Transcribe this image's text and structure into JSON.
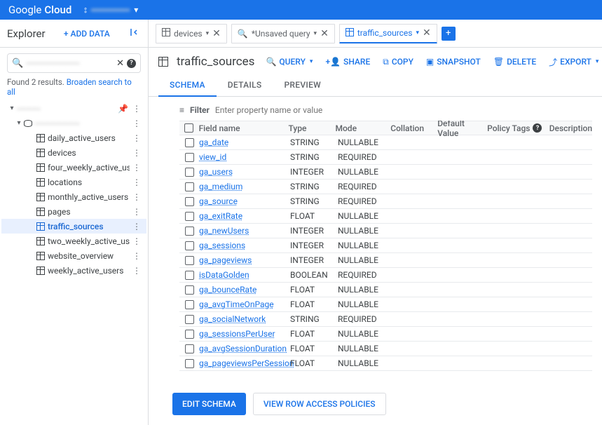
{
  "header": {
    "product": "Google",
    "product_b": "Cloud",
    "project": "▪▪▪▪▪▪▪▪▪▪▪▪▪"
  },
  "sidebar": {
    "title": "Explorer",
    "add_data": "ADD DATA",
    "search_value": "▪▪▪▪▪▪▪▪▪▪▪▪▪▪▪▪▪▪",
    "results_text": "Found 2 results.",
    "broaden": "Broaden search to all",
    "tree_project": "▪▪▪▪▪▪▪▪",
    "tree_dataset": "▪▪▪▪▪▪▪▪▪▪▪▪▪▪▪",
    "tables": [
      "daily_active_users",
      "devices",
      "four_weekly_active_users",
      "locations",
      "monthly_active_users",
      "pages",
      "traffic_sources",
      "two_weekly_active_users",
      "website_overview",
      "weekly_active_users"
    ],
    "selected_table": "traffic_sources"
  },
  "tabs": [
    {
      "icon": "table",
      "label": "devices",
      "active": false
    },
    {
      "icon": "search",
      "label": "*Unsaved query",
      "active": false
    },
    {
      "icon": "table",
      "label": "traffic_sources",
      "active": true
    }
  ],
  "page": {
    "title": "traffic_sources",
    "actions": {
      "query": "QUERY",
      "share": "SHARE",
      "copy": "COPY",
      "snapshot": "SNAPSHOT",
      "delete": "DELETE",
      "export": "EXPORT"
    },
    "subtabs": [
      "SCHEMA",
      "DETAILS",
      "PREVIEW"
    ],
    "active_subtab": "SCHEMA"
  },
  "filter": {
    "label": "Filter",
    "placeholder": "Enter property name or value"
  },
  "schema": {
    "headers": {
      "name": "Field name",
      "type": "Type",
      "mode": "Mode",
      "collation": "Collation",
      "default": "Default Value",
      "tags": "Policy Tags",
      "desc": "Description"
    },
    "fields": [
      {
        "name": "ga_date",
        "type": "STRING",
        "mode": "NULLABLE"
      },
      {
        "name": "view_id",
        "type": "STRING",
        "mode": "REQUIRED"
      },
      {
        "name": "ga_users",
        "type": "INTEGER",
        "mode": "NULLABLE"
      },
      {
        "name": "ga_medium",
        "type": "STRING",
        "mode": "REQUIRED"
      },
      {
        "name": "ga_source",
        "type": "STRING",
        "mode": "REQUIRED"
      },
      {
        "name": "ga_exitRate",
        "type": "FLOAT",
        "mode": "NULLABLE"
      },
      {
        "name": "ga_newUsers",
        "type": "INTEGER",
        "mode": "NULLABLE"
      },
      {
        "name": "ga_sessions",
        "type": "INTEGER",
        "mode": "NULLABLE"
      },
      {
        "name": "ga_pageviews",
        "type": "INTEGER",
        "mode": "NULLABLE"
      },
      {
        "name": "isDataGolden",
        "type": "BOOLEAN",
        "mode": "REQUIRED"
      },
      {
        "name": "ga_bounceRate",
        "type": "FLOAT",
        "mode": "NULLABLE"
      },
      {
        "name": "ga_avgTimeOnPage",
        "type": "FLOAT",
        "mode": "NULLABLE"
      },
      {
        "name": "ga_socialNetwork",
        "type": "STRING",
        "mode": "REQUIRED"
      },
      {
        "name": "ga_sessionsPerUser",
        "type": "FLOAT",
        "mode": "NULLABLE"
      },
      {
        "name": "ga_avgSessionDuration",
        "type": "FLOAT",
        "mode": "NULLABLE"
      },
      {
        "name": "ga_pageviewsPerSession",
        "type": "FLOAT",
        "mode": "NULLABLE"
      }
    ]
  },
  "footer": {
    "edit_schema": "EDIT SCHEMA",
    "row_policies": "VIEW ROW ACCESS POLICIES"
  }
}
